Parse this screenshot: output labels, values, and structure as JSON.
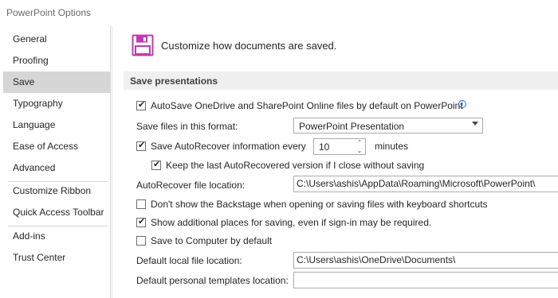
{
  "window": {
    "title": "PowerPoint Options"
  },
  "sidebar": {
    "items": [
      {
        "label": "General"
      },
      {
        "label": "Proofing"
      },
      {
        "label": "Save",
        "selected": true
      },
      {
        "label": "Typography"
      },
      {
        "label": "Language"
      },
      {
        "label": "Ease of Access"
      },
      {
        "label": "Advanced"
      },
      {
        "label": "Customize Ribbon"
      },
      {
        "label": "Quick Access Toolbar"
      },
      {
        "label": "Add-ins"
      },
      {
        "label": "Trust Center"
      }
    ]
  },
  "header": {
    "icon": "floppy-disk-icon",
    "text": "Customize how documents are saved."
  },
  "save_presentations": {
    "title": "Save presentations",
    "autosave": {
      "label": "AutoSave OneDrive and SharePoint Online files by default on PowerPoint",
      "checked": true,
      "info_icon": "info-icon"
    },
    "format": {
      "label": "Save files in this format:",
      "value": "PowerPoint Presentation"
    },
    "autorecover": {
      "label": "Save AutoRecover information every",
      "checked": true,
      "minutes_value": "10",
      "minutes_label": "minutes"
    },
    "keep_last": {
      "label": "Keep the last AutoRecovered version if I close without saving",
      "checked": true
    },
    "autorecover_location": {
      "label": "AutoRecover file location:",
      "value": "C:\\Users\\ashis\\AppData\\Roaming\\Microsoft\\PowerPoint\\"
    },
    "dont_show_backstage": {
      "label": "Don't show the Backstage when opening or saving files with keyboard shortcuts",
      "checked": false
    },
    "show_additional": {
      "label": "Show additional places for saving, even if sign-in may be required.",
      "checked": true
    },
    "save_to_computer": {
      "label": "Save to Computer by default",
      "checked": false
    },
    "default_local": {
      "label": "Default local file location:",
      "value": "C:\\Users\\ashis\\OneDrive\\Documents\\"
    },
    "default_templates": {
      "label": "Default personal templates location:",
      "value": ""
    }
  },
  "colors": {
    "accent_icon": "#c239b3",
    "selected_nav": "#d6d6d6",
    "section_bar": "#f0f0f0"
  }
}
